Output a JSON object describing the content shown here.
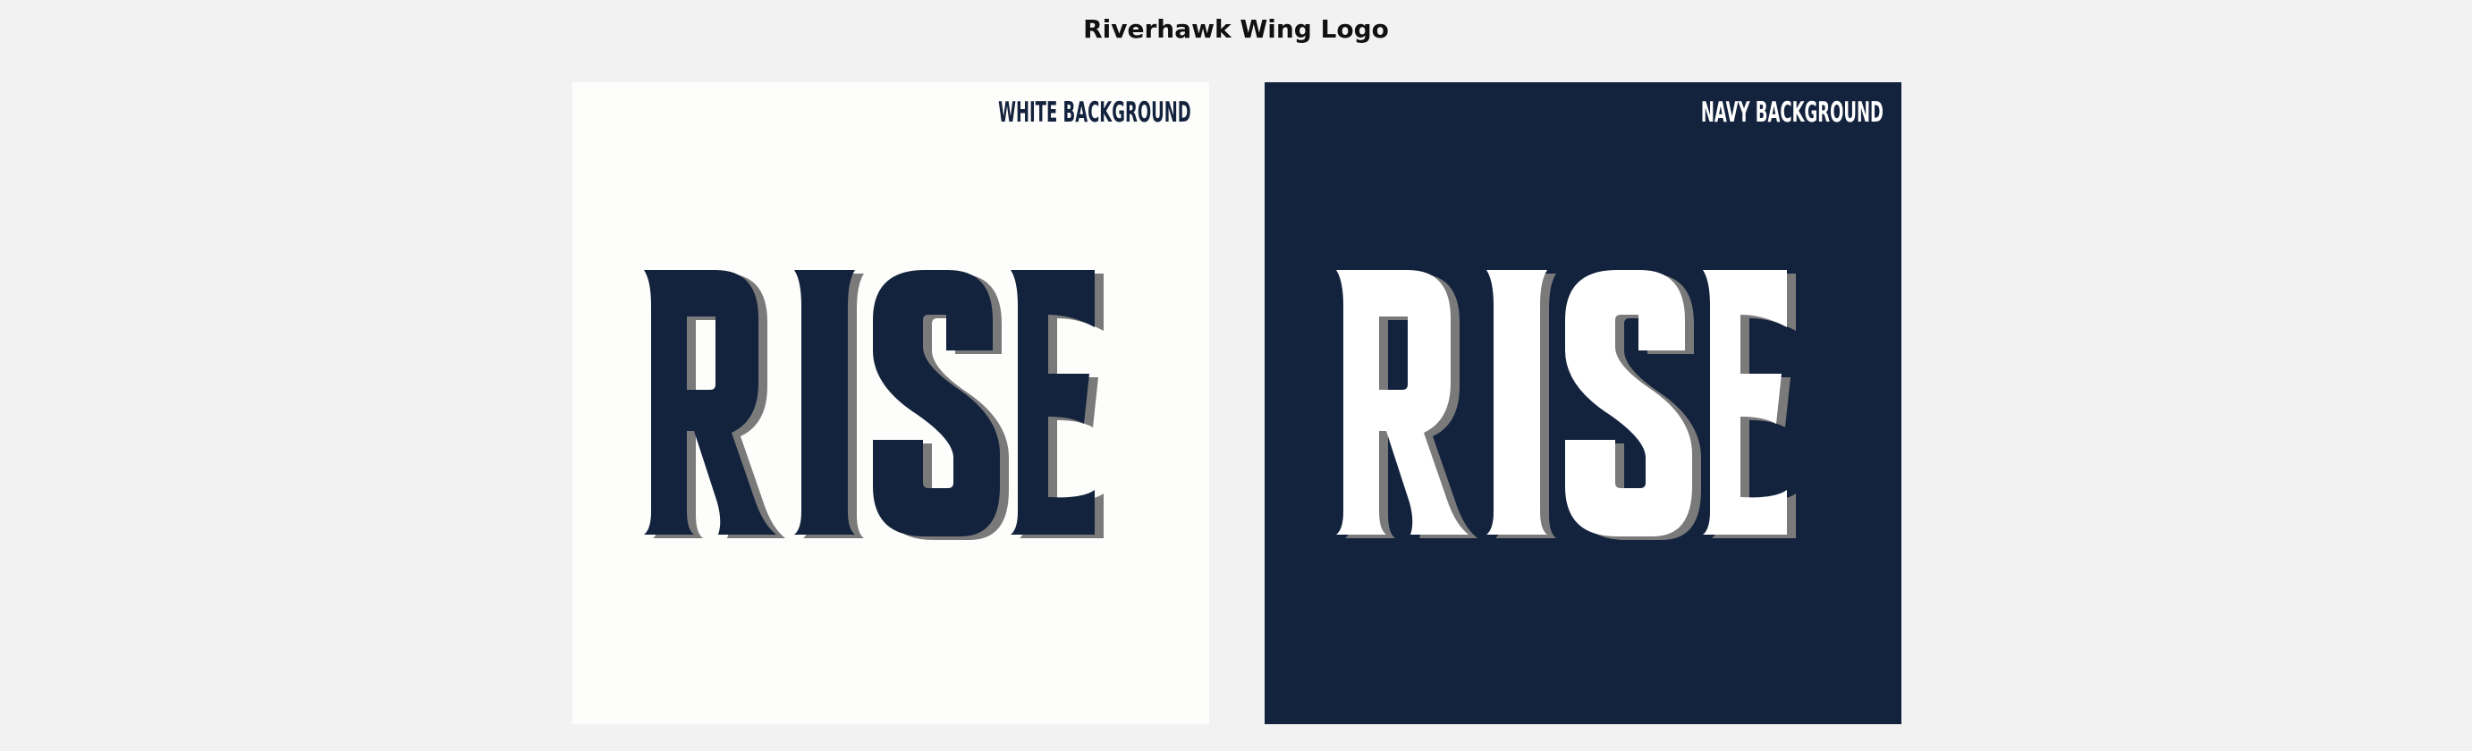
{
  "page": {
    "title": "Riverhawk Wing Logo"
  },
  "colors": {
    "page_background": "#f2f2f2",
    "white_panel": "#fdfdfb",
    "navy_panel": "#13223d",
    "navy_letters": "#13223d",
    "white_letters": "#ffffff",
    "shadow": "#7a7a7a"
  },
  "panels": [
    {
      "label": "WHITE BACKGROUND",
      "background": "#fdfdfb",
      "label_color": "#13223d",
      "logo_text": "RISE",
      "letter_color": "#13223d"
    },
    {
      "label": "NAVY BACKGROUND",
      "background": "#13223d",
      "label_color": "#ffffff",
      "logo_text": "RISE",
      "letter_color": "#ffffff"
    }
  ]
}
